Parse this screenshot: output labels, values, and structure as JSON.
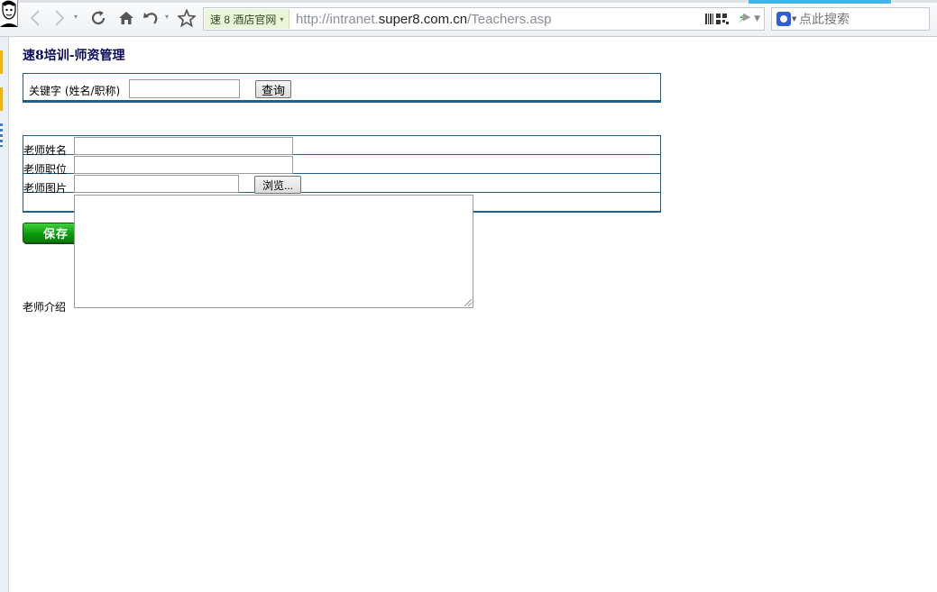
{
  "browser": {
    "site_badge": "速 8 酒店官网",
    "url_prefix": "http://intranet.",
    "url_host": "super8.com.cn",
    "url_path": "/Teachers.asp",
    "search_placeholder": "点此搜索",
    "accent": "#3fb3ea"
  },
  "page": {
    "title": "速8培训-师资管理",
    "search": {
      "keyword_label": "关键字 (姓名/职称)",
      "keyword_value": "",
      "query_button": "查询"
    },
    "form": {
      "name_label": "老师姓名",
      "position_label": "老师职位",
      "photo_label": "老师图片",
      "browse_button": "浏览...",
      "intro_label": "老师介绍",
      "name_value": "",
      "position_value": "",
      "photo_value": "",
      "intro_value": ""
    },
    "save_button": "保存",
    "save_color": "#0b9a0b",
    "border_color": "#1f5f8a"
  }
}
